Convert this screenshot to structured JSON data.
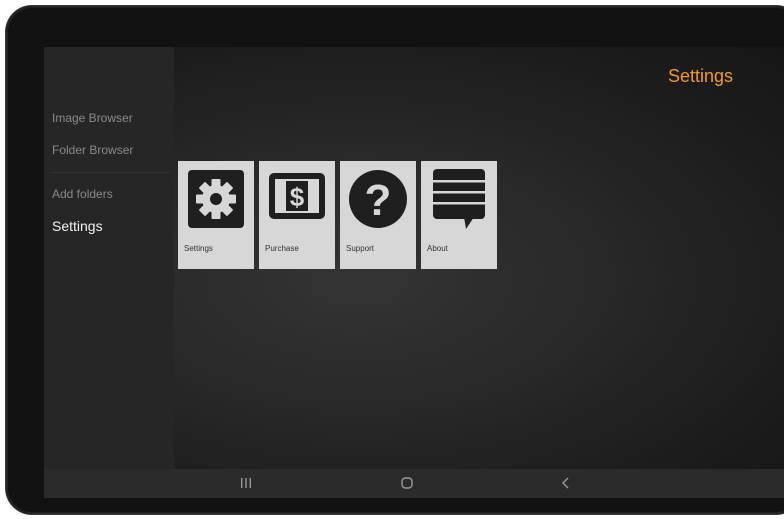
{
  "sidebar": {
    "items": [
      {
        "label": "Image Browser"
      },
      {
        "label": "Folder Browser"
      },
      {
        "label": "Add folders"
      },
      {
        "label": "Settings"
      }
    ]
  },
  "header": {
    "title": "Settings"
  },
  "tiles": [
    {
      "label": "Settings",
      "icon": "gear-icon"
    },
    {
      "label": "Purchase",
      "icon": "dollar-screen-icon"
    },
    {
      "label": "Support",
      "icon": "question-icon"
    },
    {
      "label": "About",
      "icon": "document-speech-icon"
    }
  ],
  "navbar": {
    "buttons": [
      {
        "icon": "recent-apps-icon"
      },
      {
        "icon": "home-icon"
      },
      {
        "icon": "back-icon"
      }
    ]
  },
  "colors": {
    "accent": "#f39a25",
    "tile_bg": "#d7d7d7",
    "icon_dark": "#1f1f1f"
  }
}
